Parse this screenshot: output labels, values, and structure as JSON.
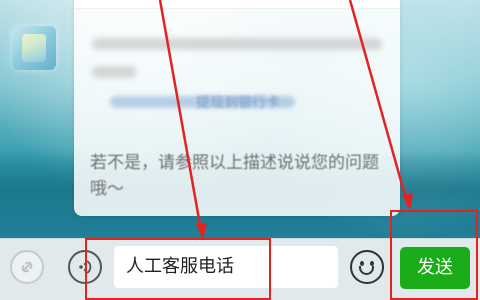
{
  "chat": {
    "link_text": "提现到银行卡",
    "reply_text": "若不是，请参照以上描述说说您的问题哦～"
  },
  "input_bar": {
    "mini_program_icon": "link-icon",
    "voice_icon": "voice-icon",
    "input_value": "人工客服电话",
    "emoji_icon": "smile-icon",
    "send_label": "发送",
    "send_color": "#1aad19"
  },
  "annotation": {
    "color": "#e3231f"
  }
}
